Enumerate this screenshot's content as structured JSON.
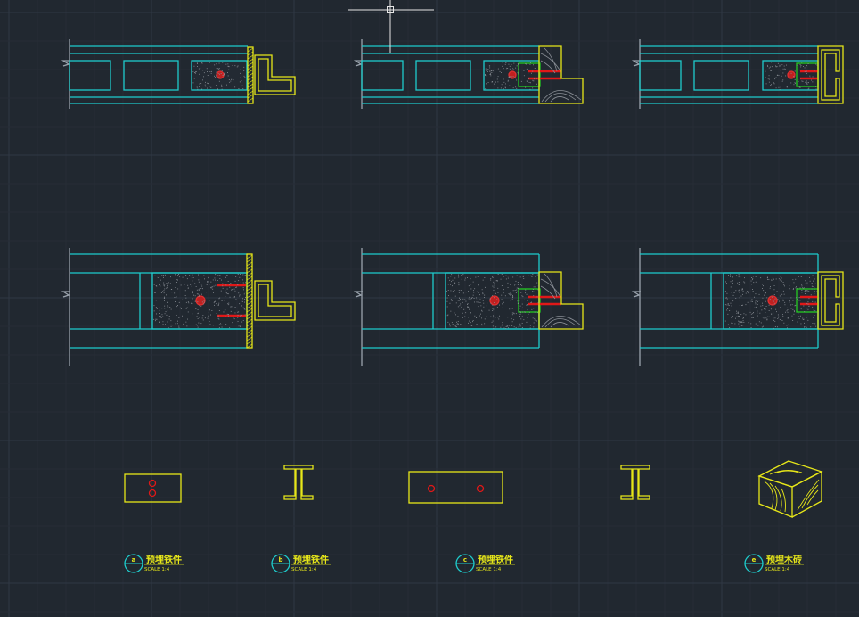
{
  "colors": {
    "background": "#212830",
    "grid_major": "#2f3844",
    "grid_minor": "#262d36",
    "cyan": "#1ecccc",
    "yellow": "#e6e619",
    "red": "#e01818",
    "green": "#22cc22",
    "grey": "#9aa3ad",
    "crosshair": "#e6e6e6",
    "dots": "#8a8f96"
  },
  "details": [
    {
      "bubble": "a",
      "title": "预埋铁件",
      "scale": "SCALE  1:4"
    },
    {
      "bubble": "b",
      "title": "预埋铁件",
      "scale": "SCALE  1:4"
    },
    {
      "bubble": "c",
      "title": "预埋铁件",
      "scale": "SCALE  1:4"
    },
    {
      "bubble": "e",
      "title": "预埋木砖",
      "scale": "SCALE  1:4"
    }
  ],
  "icons": [
    "crosshair-cursor-icon",
    "break-line-icon"
  ]
}
